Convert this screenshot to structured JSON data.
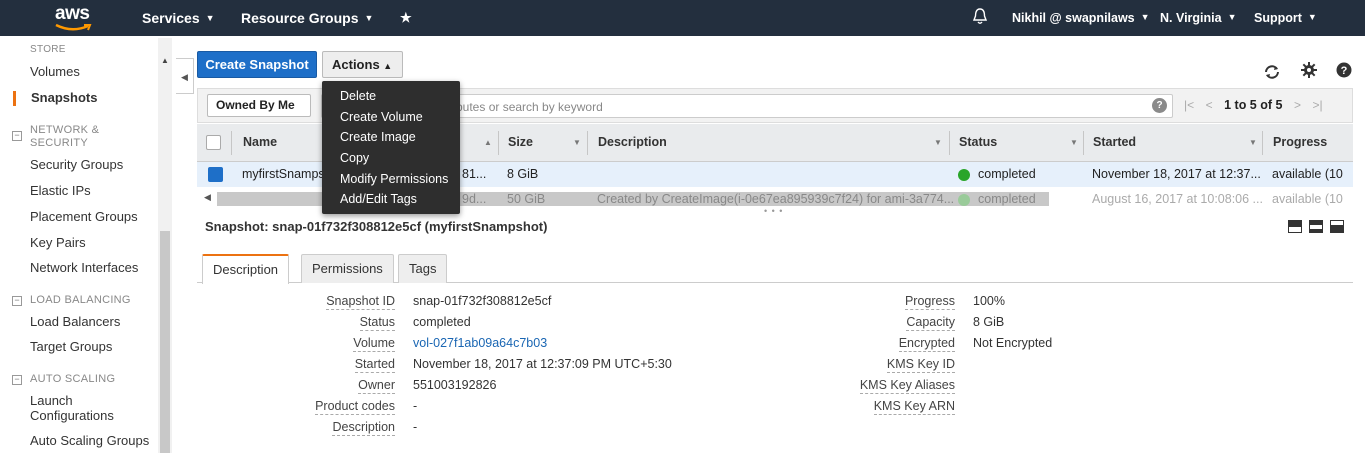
{
  "topnav": {
    "logo_text": "aws",
    "services": "Services",
    "resource_groups": "Resource Groups",
    "user": "Nikhil @ swapnilaws",
    "region": "N. Virginia",
    "support": "Support",
    "icons": [
      "pin-icon",
      "bell-icon"
    ]
  },
  "sidebar": {
    "store_partial": "STORE",
    "volumes": "Volumes",
    "snapshots": "Snapshots",
    "network_header": "NETWORK &",
    "network_header2": "SECURITY",
    "security_groups": "Security Groups",
    "elastic_ips": "Elastic IPs",
    "placement_groups": "Placement Groups",
    "key_pairs": "Key Pairs",
    "network_interfaces": "Network Interfaces",
    "lb_header": "LOAD BALANCING",
    "load_balancers": "Load Balancers",
    "target_groups": "Target Groups",
    "as_header": "AUTO SCALING",
    "launch_configs_1": "Launch",
    "launch_configs_2": "Configurations",
    "as_groups": "Auto Scaling Groups",
    "accent_color": "#ec7211"
  },
  "toolbar": {
    "create_snapshot": "Create Snapshot",
    "actions": "Actions",
    "icons": [
      "refresh-icon",
      "gear-icon",
      "help-icon"
    ],
    "primary_color": "#1e6fc8"
  },
  "filter": {
    "owned_by": "Owned By Me",
    "search_placeholder_visible": "butes or search by keyword",
    "pager": "1 to 5 of 5"
  },
  "table": {
    "headers": [
      "Name",
      "Size",
      "Description",
      "Status",
      "Started",
      "Progress"
    ],
    "rows": [
      {
        "name": "myfirstSnamps",
        "id_partial": "81...",
        "size": "8 GiB",
        "description": "",
        "status": "completed",
        "started": "November 18, 2017 at 12:37...",
        "progress": "available (10"
      },
      {
        "name": "",
        "id_partial": "9d...",
        "size": "50 GiB",
        "description": "Created by CreateImage(i-0e67ea895939c7f24) for ami-3a774...",
        "status": "completed",
        "started": "August 16, 2017 at 10:08:06 ...",
        "progress": "available (10"
      }
    ]
  },
  "actions_menu": {
    "items": [
      "Delete",
      "Create Volume",
      "Create Image",
      "Copy",
      "Modify Permissions",
      "Add/Edit Tags"
    ]
  },
  "detail": {
    "title": "Snapshot: snap-01f732f308812e5cf (myfirstSnampshot)",
    "tabs": [
      "Description",
      "Permissions",
      "Tags"
    ],
    "left": [
      {
        "label": "Snapshot ID",
        "value": "snap-01f732f308812e5cf"
      },
      {
        "label": "Status",
        "value": "completed"
      },
      {
        "label": "Volume",
        "value": "vol-027f1ab09a64c7b03"
      },
      {
        "label": "Started",
        "value": "November 18, 2017 at 12:37:09 PM UTC+5:30"
      },
      {
        "label": "Owner",
        "value": "551003192826"
      },
      {
        "label": "Product codes",
        "value": "-"
      },
      {
        "label": "Description",
        "value": "-"
      }
    ],
    "right": [
      {
        "label": "Progress",
        "value": "100%"
      },
      {
        "label": "Capacity",
        "value": "8 GiB"
      },
      {
        "label": "Encrypted",
        "value": "Not Encrypted"
      },
      {
        "label": "KMS Key ID",
        "value": ""
      },
      {
        "label": "KMS Key Aliases",
        "value": ""
      },
      {
        "label": "KMS Key ARN",
        "value": ""
      }
    ]
  }
}
